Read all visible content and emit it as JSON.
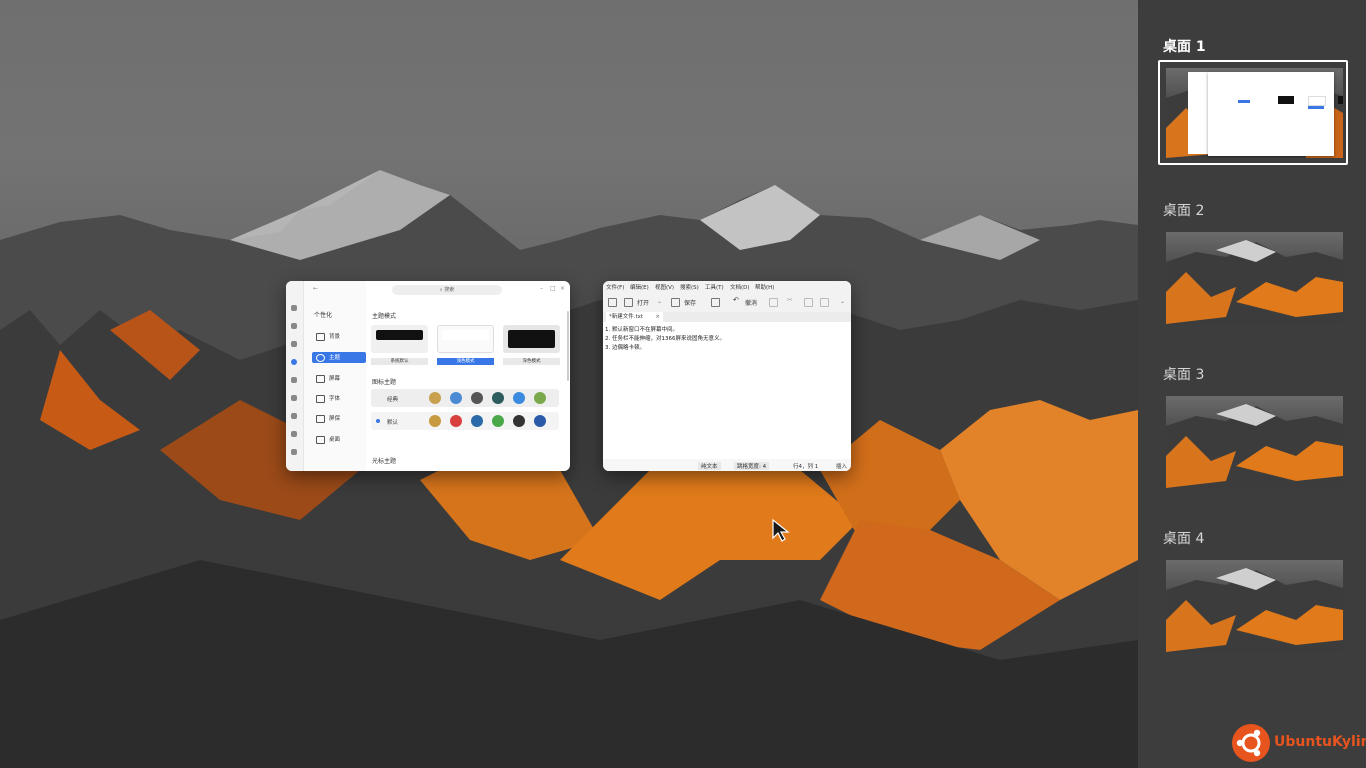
{
  "settings_window": {
    "search_placeholder": "搜索",
    "section_title": "个性化",
    "nav_items": [
      {
        "label": "背景",
        "selected": false
      },
      {
        "label": "主题",
        "selected": true
      },
      {
        "label": "屏幕",
        "selected": false
      },
      {
        "label": "字体",
        "selected": false
      },
      {
        "label": "屏保",
        "selected": false
      },
      {
        "label": "桌面",
        "selected": false
      }
    ],
    "theme_mode_title": "主题模式",
    "theme_modes": [
      {
        "label": "系统默认",
        "selected": false
      },
      {
        "label": "浅色模式",
        "selected": true
      },
      {
        "label": "深色模式",
        "selected": false
      }
    ],
    "icon_theme_title": "图标主题",
    "icon_themes": [
      {
        "label": "经典",
        "selected": false
      },
      {
        "label": "默认",
        "selected": true
      }
    ],
    "cursor_theme_title": "光标主题"
  },
  "editor_window": {
    "menu": [
      "文件(F)",
      "编辑(E)",
      "视图(V)",
      "搜索(S)",
      "工具(T)",
      "文档(D)",
      "帮助(H)"
    ],
    "toolbar": {
      "open": "打开",
      "save": "保存",
      "undo": "撤消"
    },
    "tab_title": "*新建文件.txt",
    "lines": [
      "1. 默认新窗口不在屏幕中间。",
      "2. 任务栏不能伸缩，对1366屏来说固角无意义。",
      "3. 边偶略卡顿。"
    ],
    "status": {
      "mode": "纯文本",
      "tab_width": "跳格宽度: 4",
      "position": "行4，列 1",
      "insert": "插入"
    }
  },
  "workspaces": [
    {
      "label": "桌面 1",
      "active": true
    },
    {
      "label": "桌面 2",
      "active": false
    },
    {
      "label": "桌面 3",
      "active": false
    },
    {
      "label": "桌面 4",
      "active": false
    }
  ],
  "brand": {
    "name": "UbuntuKylin",
    "color": "#e8541e"
  }
}
